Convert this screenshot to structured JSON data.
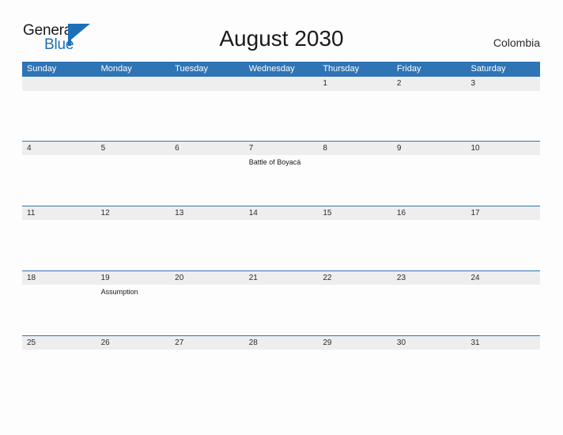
{
  "brand": {
    "name_part1": "General",
    "name_part2": "Blue",
    "logo_icon": "triangle-flag-icon",
    "colors": {
      "blue": "#1c70b8",
      "header_blue": "#2f74b5",
      "band_gray": "#eeeeee"
    }
  },
  "header": {
    "title": "August 2030",
    "country": "Colombia"
  },
  "calendar": {
    "weekdays": [
      "Sunday",
      "Monday",
      "Tuesday",
      "Wednesday",
      "Thursday",
      "Friday",
      "Saturday"
    ],
    "weeks": [
      {
        "days": [
          {
            "num": "",
            "events": []
          },
          {
            "num": "",
            "events": []
          },
          {
            "num": "",
            "events": []
          },
          {
            "num": "",
            "events": []
          },
          {
            "num": "1",
            "events": []
          },
          {
            "num": "2",
            "events": []
          },
          {
            "num": "3",
            "events": []
          }
        ]
      },
      {
        "days": [
          {
            "num": "4",
            "events": []
          },
          {
            "num": "5",
            "events": []
          },
          {
            "num": "6",
            "events": []
          },
          {
            "num": "7",
            "events": [
              "Battle of Boyacá"
            ]
          },
          {
            "num": "8",
            "events": []
          },
          {
            "num": "9",
            "events": []
          },
          {
            "num": "10",
            "events": []
          }
        ]
      },
      {
        "days": [
          {
            "num": "11",
            "events": []
          },
          {
            "num": "12",
            "events": []
          },
          {
            "num": "13",
            "events": []
          },
          {
            "num": "14",
            "events": []
          },
          {
            "num": "15",
            "events": []
          },
          {
            "num": "16",
            "events": []
          },
          {
            "num": "17",
            "events": []
          }
        ]
      },
      {
        "days": [
          {
            "num": "18",
            "events": []
          },
          {
            "num": "19",
            "events": [
              "Assumption"
            ]
          },
          {
            "num": "20",
            "events": []
          },
          {
            "num": "21",
            "events": []
          },
          {
            "num": "22",
            "events": []
          },
          {
            "num": "23",
            "events": []
          },
          {
            "num": "24",
            "events": []
          }
        ]
      },
      {
        "days": [
          {
            "num": "25",
            "events": []
          },
          {
            "num": "26",
            "events": []
          },
          {
            "num": "27",
            "events": []
          },
          {
            "num": "28",
            "events": []
          },
          {
            "num": "29",
            "events": []
          },
          {
            "num": "30",
            "events": []
          },
          {
            "num": "31",
            "events": []
          }
        ]
      }
    ]
  }
}
